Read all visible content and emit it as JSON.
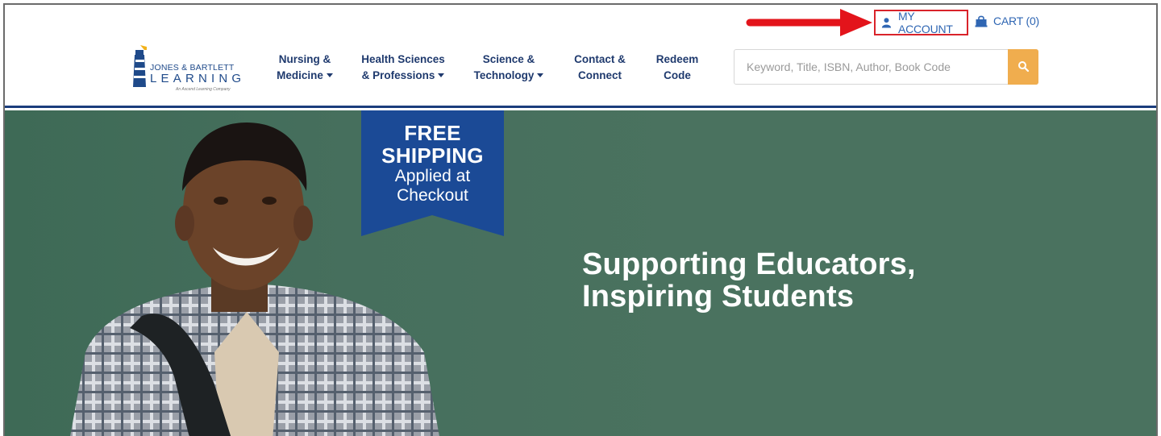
{
  "header": {
    "logo": {
      "line1": "JONES & BARTLETT",
      "line2": "LEARNING",
      "tagline": "An Ascend Learning Company"
    },
    "nav": [
      {
        "line1": "Nursing &",
        "line2": "Medicine",
        "dropdown": true
      },
      {
        "line1": "Health Sciences",
        "line2": "& Professions",
        "dropdown": true
      },
      {
        "line1": "Science &",
        "line2": "Technology",
        "dropdown": true
      },
      {
        "line1": "Contact &",
        "line2": "Connect",
        "dropdown": false
      },
      {
        "line1": "Redeem",
        "line2": "Code",
        "dropdown": false
      }
    ],
    "search": {
      "placeholder": "Keyword, Title, ISBN, Author, Book Code",
      "value": "",
      "button_icon": "search-icon"
    },
    "account_label": "MY ACCOUNT",
    "cart_label": "CART (0)"
  },
  "hero": {
    "banner": {
      "line1": "FREE",
      "line2": "SHIPPING",
      "line3": "Applied at",
      "line4": "Checkout"
    },
    "headline_line1": "Supporting Educators,",
    "headline_line2": "Inspiring Students"
  },
  "annotation": {
    "type": "arrow",
    "color": "#e3141b",
    "target": "MY ACCOUNT"
  },
  "colors": {
    "brand_blue": "#1f3a6e",
    "link_blue": "#2f66b3",
    "search_button": "#f0ad4e",
    "banner_blue": "#1b4a96",
    "hero_green": "#4a725f",
    "highlight_red": "#d9232a"
  }
}
